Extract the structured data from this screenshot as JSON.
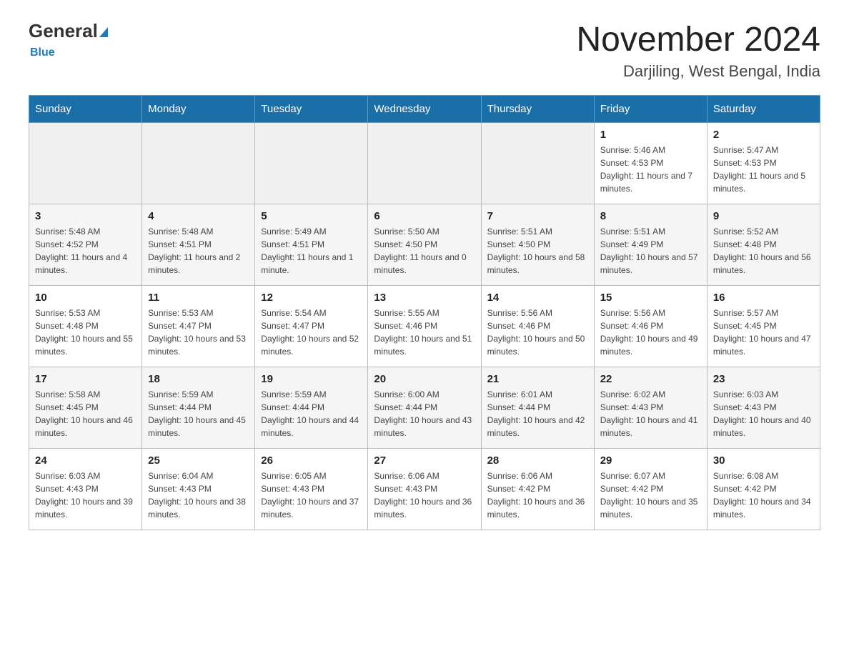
{
  "header": {
    "logo_text_general": "General",
    "logo_text_blue": "Blue",
    "month_year": "November 2024",
    "location": "Darjiling, West Bengal, India"
  },
  "weekdays": [
    "Sunday",
    "Monday",
    "Tuesday",
    "Wednesday",
    "Thursday",
    "Friday",
    "Saturday"
  ],
  "weeks": [
    {
      "days": [
        {
          "number": "",
          "info": ""
        },
        {
          "number": "",
          "info": ""
        },
        {
          "number": "",
          "info": ""
        },
        {
          "number": "",
          "info": ""
        },
        {
          "number": "",
          "info": ""
        },
        {
          "number": "1",
          "info": "Sunrise: 5:46 AM\nSunset: 4:53 PM\nDaylight: 11 hours and 7 minutes."
        },
        {
          "number": "2",
          "info": "Sunrise: 5:47 AM\nSunset: 4:53 PM\nDaylight: 11 hours and 5 minutes."
        }
      ]
    },
    {
      "days": [
        {
          "number": "3",
          "info": "Sunrise: 5:48 AM\nSunset: 4:52 PM\nDaylight: 11 hours and 4 minutes."
        },
        {
          "number": "4",
          "info": "Sunrise: 5:48 AM\nSunset: 4:51 PM\nDaylight: 11 hours and 2 minutes."
        },
        {
          "number": "5",
          "info": "Sunrise: 5:49 AM\nSunset: 4:51 PM\nDaylight: 11 hours and 1 minute."
        },
        {
          "number": "6",
          "info": "Sunrise: 5:50 AM\nSunset: 4:50 PM\nDaylight: 11 hours and 0 minutes."
        },
        {
          "number": "7",
          "info": "Sunrise: 5:51 AM\nSunset: 4:50 PM\nDaylight: 10 hours and 58 minutes."
        },
        {
          "number": "8",
          "info": "Sunrise: 5:51 AM\nSunset: 4:49 PM\nDaylight: 10 hours and 57 minutes."
        },
        {
          "number": "9",
          "info": "Sunrise: 5:52 AM\nSunset: 4:48 PM\nDaylight: 10 hours and 56 minutes."
        }
      ]
    },
    {
      "days": [
        {
          "number": "10",
          "info": "Sunrise: 5:53 AM\nSunset: 4:48 PM\nDaylight: 10 hours and 55 minutes."
        },
        {
          "number": "11",
          "info": "Sunrise: 5:53 AM\nSunset: 4:47 PM\nDaylight: 10 hours and 53 minutes."
        },
        {
          "number": "12",
          "info": "Sunrise: 5:54 AM\nSunset: 4:47 PM\nDaylight: 10 hours and 52 minutes."
        },
        {
          "number": "13",
          "info": "Sunrise: 5:55 AM\nSunset: 4:46 PM\nDaylight: 10 hours and 51 minutes."
        },
        {
          "number": "14",
          "info": "Sunrise: 5:56 AM\nSunset: 4:46 PM\nDaylight: 10 hours and 50 minutes."
        },
        {
          "number": "15",
          "info": "Sunrise: 5:56 AM\nSunset: 4:46 PM\nDaylight: 10 hours and 49 minutes."
        },
        {
          "number": "16",
          "info": "Sunrise: 5:57 AM\nSunset: 4:45 PM\nDaylight: 10 hours and 47 minutes."
        }
      ]
    },
    {
      "days": [
        {
          "number": "17",
          "info": "Sunrise: 5:58 AM\nSunset: 4:45 PM\nDaylight: 10 hours and 46 minutes."
        },
        {
          "number": "18",
          "info": "Sunrise: 5:59 AM\nSunset: 4:44 PM\nDaylight: 10 hours and 45 minutes."
        },
        {
          "number": "19",
          "info": "Sunrise: 5:59 AM\nSunset: 4:44 PM\nDaylight: 10 hours and 44 minutes."
        },
        {
          "number": "20",
          "info": "Sunrise: 6:00 AM\nSunset: 4:44 PM\nDaylight: 10 hours and 43 minutes."
        },
        {
          "number": "21",
          "info": "Sunrise: 6:01 AM\nSunset: 4:44 PM\nDaylight: 10 hours and 42 minutes."
        },
        {
          "number": "22",
          "info": "Sunrise: 6:02 AM\nSunset: 4:43 PM\nDaylight: 10 hours and 41 minutes."
        },
        {
          "number": "23",
          "info": "Sunrise: 6:03 AM\nSunset: 4:43 PM\nDaylight: 10 hours and 40 minutes."
        }
      ]
    },
    {
      "days": [
        {
          "number": "24",
          "info": "Sunrise: 6:03 AM\nSunset: 4:43 PM\nDaylight: 10 hours and 39 minutes."
        },
        {
          "number": "25",
          "info": "Sunrise: 6:04 AM\nSunset: 4:43 PM\nDaylight: 10 hours and 38 minutes."
        },
        {
          "number": "26",
          "info": "Sunrise: 6:05 AM\nSunset: 4:43 PM\nDaylight: 10 hours and 37 minutes."
        },
        {
          "number": "27",
          "info": "Sunrise: 6:06 AM\nSunset: 4:43 PM\nDaylight: 10 hours and 36 minutes."
        },
        {
          "number": "28",
          "info": "Sunrise: 6:06 AM\nSunset: 4:42 PM\nDaylight: 10 hours and 36 minutes."
        },
        {
          "number": "29",
          "info": "Sunrise: 6:07 AM\nSunset: 4:42 PM\nDaylight: 10 hours and 35 minutes."
        },
        {
          "number": "30",
          "info": "Sunrise: 6:08 AM\nSunset: 4:42 PM\nDaylight: 10 hours and 34 minutes."
        }
      ]
    }
  ]
}
